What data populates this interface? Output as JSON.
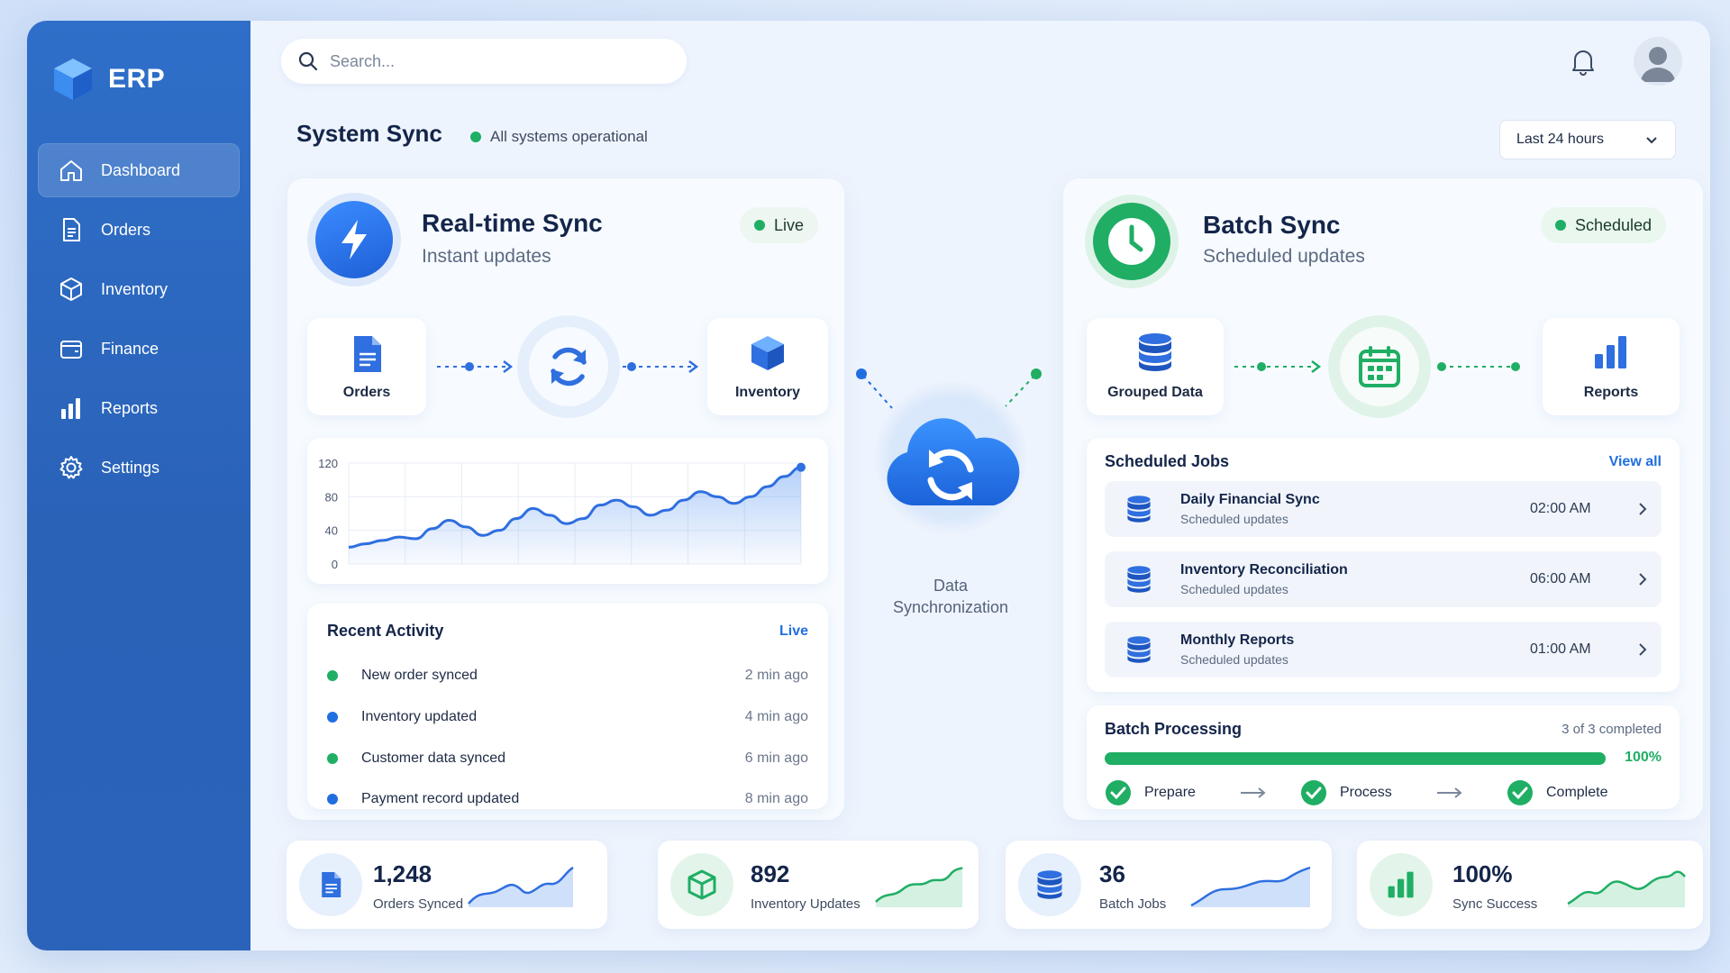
{
  "app": {
    "brand": "ERP"
  },
  "sidebar": {
    "items": [
      {
        "label": "Dashboard",
        "icon": "home-icon",
        "active": true
      },
      {
        "label": "Orders",
        "icon": "document-icon"
      },
      {
        "label": "Inventory",
        "icon": "box-icon"
      },
      {
        "label": "Finance",
        "icon": "wallet-icon"
      },
      {
        "label": "Reports",
        "icon": "bar-chart-icon"
      },
      {
        "label": "Settings",
        "icon": "gear-icon"
      }
    ]
  },
  "search": {
    "placeholder": "Search..."
  },
  "header": {
    "title": "System Sync",
    "status": "All systems operational",
    "range": "Last 24 hours"
  },
  "realtime": {
    "title": "Real-time Sync",
    "subtitle": "Instant updates",
    "badge": "Live",
    "source": "Orders",
    "target": "Inventory",
    "chart_data": {
      "type": "area",
      "y_ticks": [
        120,
        80,
        40,
        0
      ],
      "ylim": [
        0,
        120
      ],
      "grid": true,
      "values": [
        20,
        24,
        28,
        32,
        30,
        42,
        52,
        44,
        34,
        40,
        54,
        66,
        58,
        48,
        54,
        70,
        76,
        68,
        58,
        64,
        76,
        86,
        80,
        72,
        80,
        92,
        104,
        115
      ]
    }
  },
  "activity": {
    "title": "Recent Activity",
    "badge": "Live",
    "items": [
      {
        "text": "New order synced",
        "time": "2 min ago",
        "color": "#1fae64"
      },
      {
        "text": "Inventory updated",
        "time": "4 min ago",
        "color": "#1f6fe0"
      },
      {
        "text": "Customer data synced",
        "time": "6 min ago",
        "color": "#1fae64"
      },
      {
        "text": "Payment record updated",
        "time": "8 min ago",
        "color": "#1f6fe0"
      }
    ]
  },
  "center": {
    "label": "Data Synchronization"
  },
  "batch": {
    "title": "Batch Sync",
    "subtitle": "Scheduled updates",
    "badge": "Scheduled",
    "source": "Grouped Data",
    "target": "Reports"
  },
  "jobs": {
    "title": "Scheduled Jobs",
    "view_all": "View all",
    "items": [
      {
        "name": "Daily Financial Sync",
        "desc": "Scheduled updates",
        "time": "02:00 AM"
      },
      {
        "name": "Inventory Reconciliation",
        "desc": "Scheduled updates",
        "time": "06:00 AM"
      },
      {
        "name": "Monthly Reports",
        "desc": "Scheduled updates",
        "time": "01:00 AM"
      }
    ]
  },
  "processing": {
    "title": "Batch Processing",
    "completed": "3 of 3 completed",
    "percent_label": "100%",
    "progress": 1.0,
    "steps": [
      "Prepare",
      "Process",
      "Complete"
    ]
  },
  "stats": [
    {
      "value": "1,248",
      "label": "Orders Synced",
      "icon": "document-icon",
      "color": "#2f6fdf"
    },
    {
      "value": "892",
      "label": "Inventory Updates",
      "icon": "box-icon",
      "color": "#1fae64"
    },
    {
      "value": "36",
      "label": "Batch Jobs",
      "icon": "database-icon",
      "color": "#2f6fdf"
    },
    {
      "value": "100%",
      "label": "Sync Success",
      "icon": "bar-chart-icon",
      "color": "#1fae64"
    }
  ],
  "colors": {
    "primary": "#2f6fdf",
    "success": "#1fae64",
    "sidebar": "#2a62b8"
  }
}
